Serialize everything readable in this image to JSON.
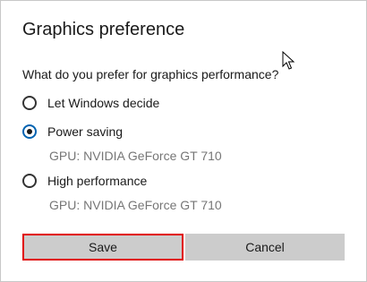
{
  "dialog": {
    "title": "Graphics preference",
    "question": "What do you prefer for graphics performance?",
    "options": [
      {
        "label": "Let Windows decide",
        "selected": false,
        "note": ""
      },
      {
        "label": "Power saving",
        "selected": true,
        "note": "GPU: NVIDIA GeForce GT 710"
      },
      {
        "label": "High performance",
        "selected": false,
        "note": "GPU: NVIDIA GeForce GT 710"
      }
    ],
    "buttons": {
      "save": "Save",
      "cancel": "Cancel"
    }
  },
  "colors": {
    "accent": "#0063b1",
    "highlight": "#e00000",
    "button_bg": "#cccccc",
    "secondary_text": "#767676"
  },
  "icons": {
    "cursor": "mouse-pointer-icon"
  }
}
